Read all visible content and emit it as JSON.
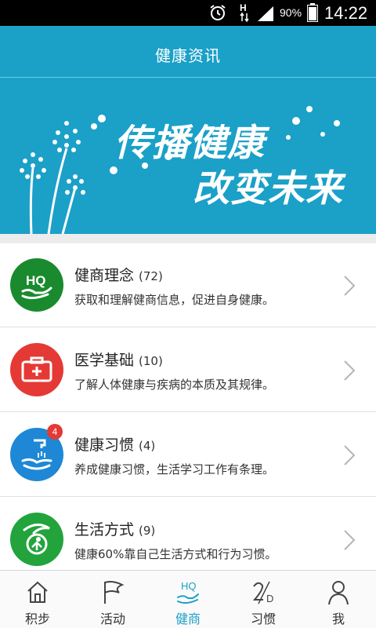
{
  "status_bar": {
    "battery_percent": "90%",
    "time": "14:22",
    "icons": [
      "alarm-clock-icon",
      "hplus-data-icon",
      "signal-icon",
      "battery-icon"
    ]
  },
  "header": {
    "title": "健康资讯"
  },
  "banner": {
    "slogan_line1": "传播健康",
    "slogan_line2": "改变未来"
  },
  "categories": [
    {
      "title": "健商理念",
      "count": "(72)",
      "description": "获取和理解健商信息，促进自身健康。",
      "icon": "hq-hand-icon",
      "color": "#1a8a2e"
    },
    {
      "title": "医学基础",
      "count": "(10)",
      "description": "了解人体健康与疾病的本质及其规律。",
      "icon": "medical-kit-icon",
      "color": "#e53935"
    },
    {
      "title": "健康习惯",
      "count": "(4)",
      "description": "养成健康习惯，生活学习工作有条理。",
      "icon": "hand-washing-icon",
      "color": "#1e88d6",
      "badge": "4"
    },
    {
      "title": "生活方式",
      "count": "(9)",
      "description": "健康60%靠自己生活方式和行为习惯。",
      "icon": "lifestyle-person-icon",
      "color": "#22a33c"
    }
  ],
  "tabs": [
    {
      "label": "积步",
      "icon": "home-icon",
      "active": false
    },
    {
      "label": "活动",
      "icon": "flag-icon",
      "active": false
    },
    {
      "label": "健商",
      "icon": "hq-icon",
      "active": true,
      "icon_text": "HQ"
    },
    {
      "label": "习惯",
      "icon": "habit-2d-icon",
      "active": false,
      "icon_text": "2D"
    },
    {
      "label": "我",
      "icon": "person-icon",
      "active": false
    }
  ],
  "colors": {
    "accent": "#1ba0c8",
    "active_tab": "#1ba0c8"
  }
}
